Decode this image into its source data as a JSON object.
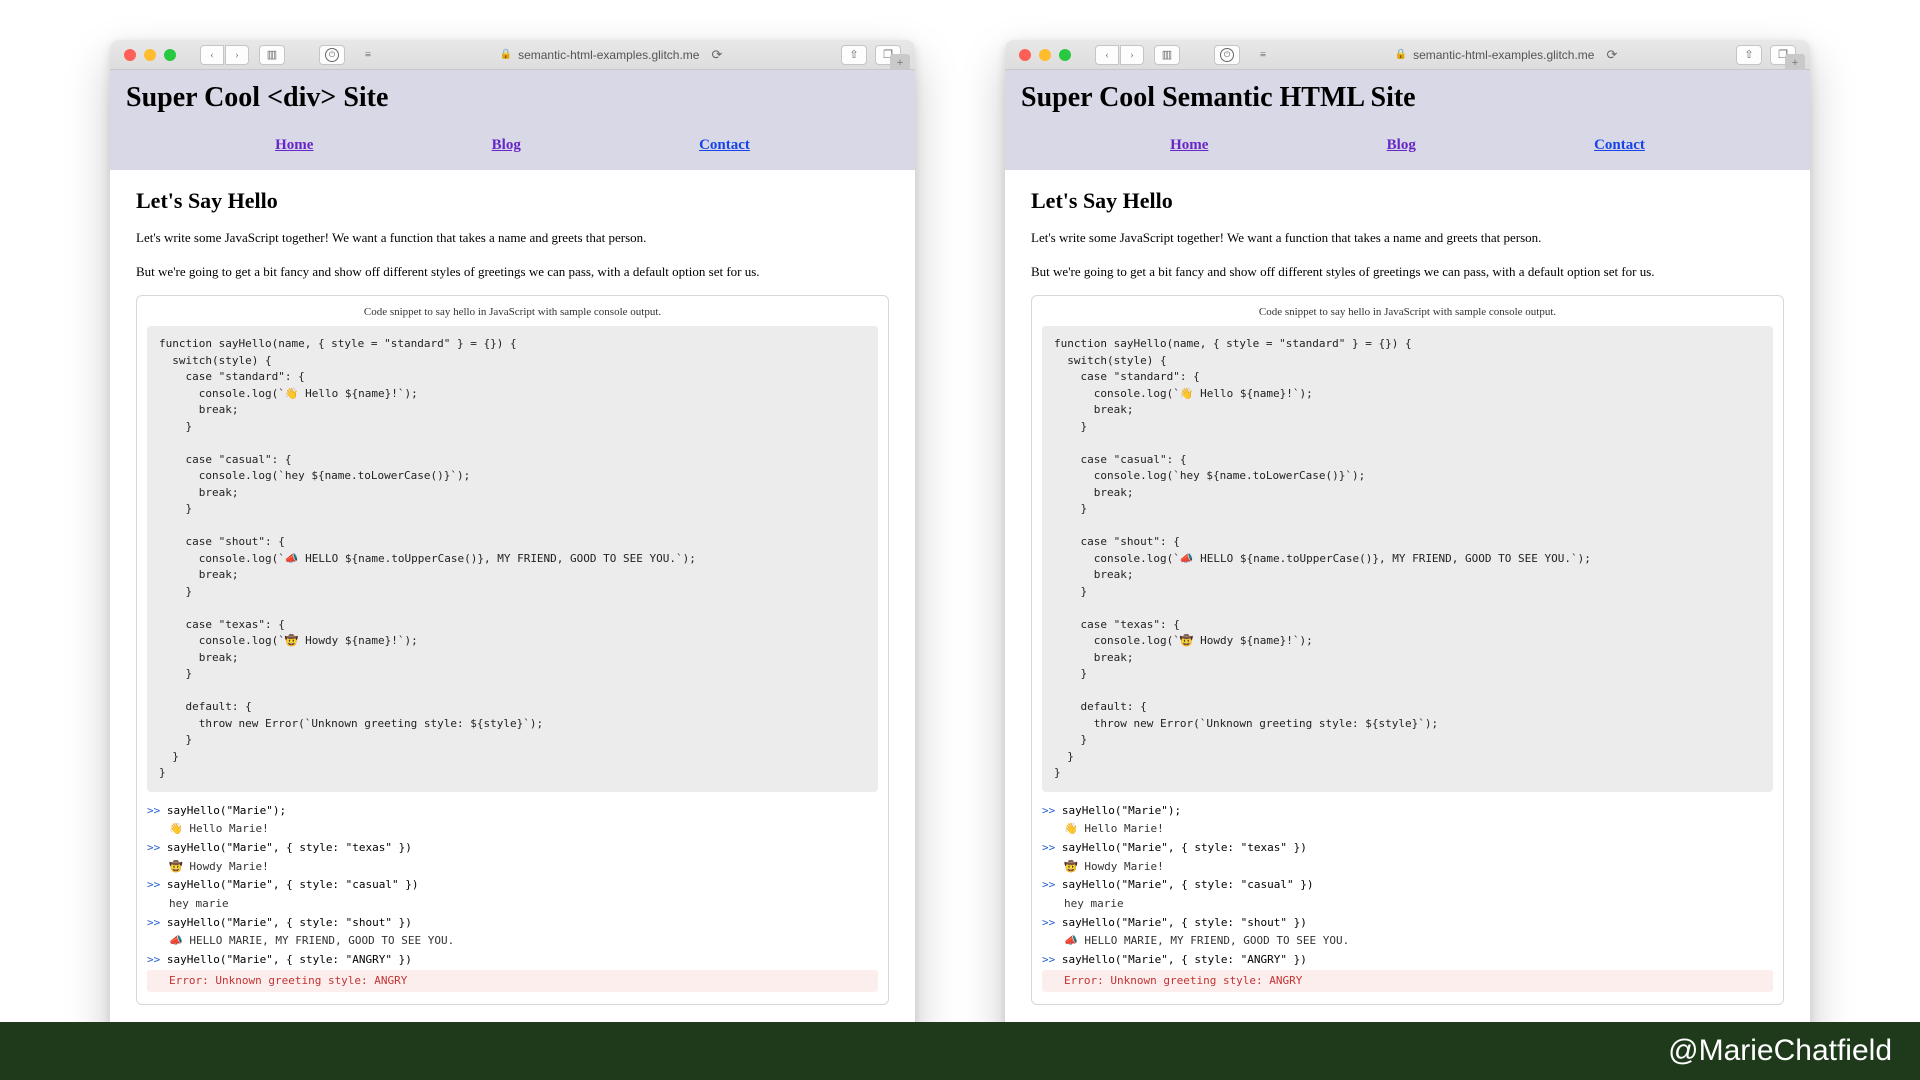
{
  "footer": {
    "handle": "@MarieChatfield"
  },
  "browser": {
    "url": "semantic-html-examples.glitch.me"
  },
  "left": {
    "title": "Super Cool <div> Site",
    "nav": {
      "home": "Home",
      "blog": "Blog",
      "contact": "Contact"
    }
  },
  "right": {
    "title": "Super Cool Semantic HTML Site",
    "nav": {
      "home": "Home",
      "blog": "Blog",
      "contact": "Contact"
    }
  },
  "article": {
    "heading": "Let's Say Hello",
    "p1": "Let's write some JavaScript together! We want a function that takes a name and greets that person.",
    "p2": "But we're going to get a bit fancy and show off different styles of greetings we can pass, with a default option set for us.",
    "caption": "Code snippet to say hello in JavaScript with sample console output.",
    "code": "function sayHello(name, { style = \"standard\" } = {}) {\n  switch(style) {\n    case \"standard\": {\n      console.log(`👋 Hello ${name}!`);\n      break;\n    }\n\n    case \"casual\": {\n      console.log(`hey ${name.toLowerCase()}`);\n      break;\n    }\n\n    case \"shout\": {\n      console.log(`📣 HELLO ${name.toUpperCase()}, MY FRIEND, GOOD TO SEE YOU.`);\n      break;\n    }\n\n    case \"texas\": {\n      console.log(`🤠 Howdy ${name}!`);\n      break;\n    }\n\n    default: {\n      throw new Error(`Unknown greeting style: ${style}`);\n    }\n  }\n}",
    "console": [
      {
        "in": ">> sayHello(\"Marie\");",
        "out": "👋 Hello Marie!",
        "err": false
      },
      {
        "in": ">> sayHello(\"Marie\", { style: \"texas\" })",
        "out": "🤠 Howdy Marie!",
        "err": false
      },
      {
        "in": ">> sayHello(\"Marie\", { style: \"casual\" })",
        "out": "hey marie",
        "err": false
      },
      {
        "in": ">> sayHello(\"Marie\", { style: \"shout\" })",
        "out": "📣 HELLO MARIE, MY FRIEND, GOOD TO SEE YOU.",
        "err": false
      },
      {
        "in": ">> sayHello(\"Marie\", { style: \"ANGRY\" })",
        "out": "Error: Unknown greeting style: ANGRY",
        "err": true
      }
    ]
  }
}
